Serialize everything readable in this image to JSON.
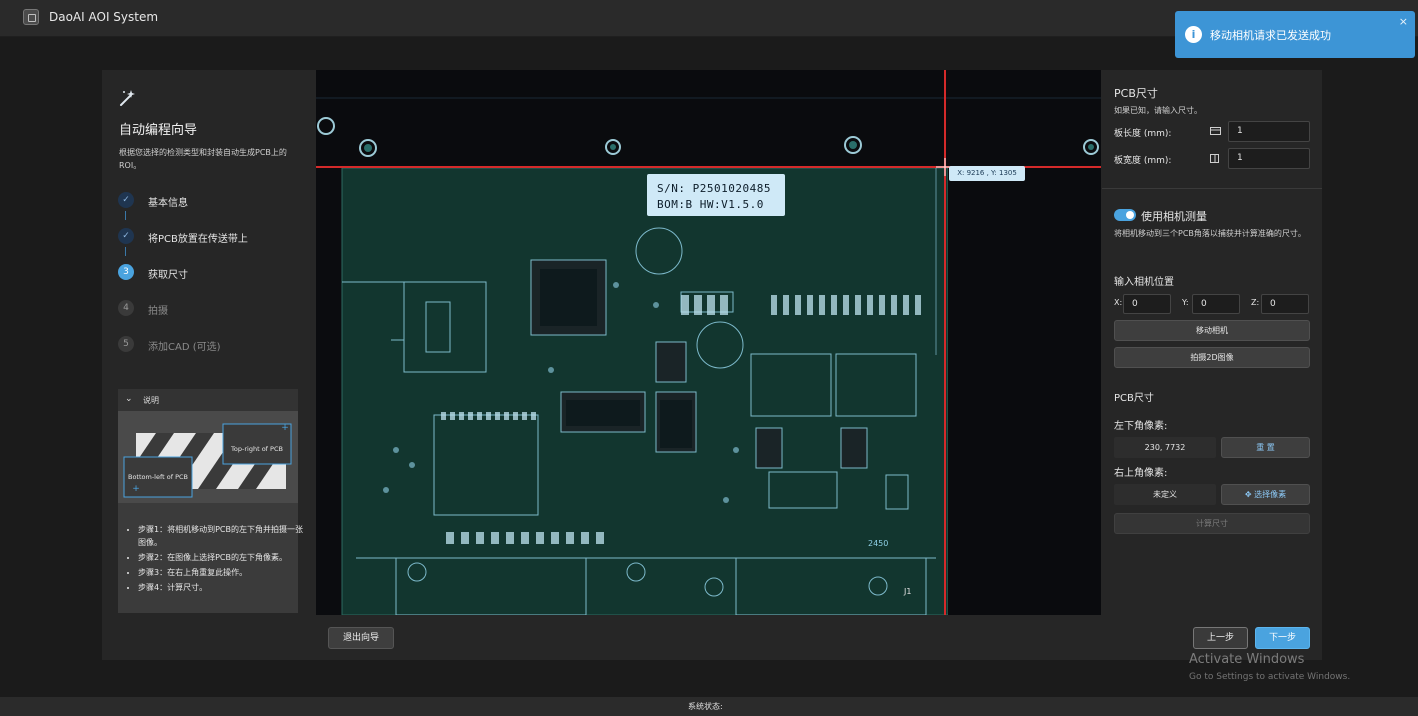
{
  "app": {
    "title": "DaoAI AOI System"
  },
  "notification": {
    "message": "移动相机请求已发送成功",
    "close": "×"
  },
  "wizard": {
    "title": "自动编程向导",
    "description": "根据您选择的检测类型和封装自动生成PCB上的ROI。",
    "steps": [
      {
        "number": "✓",
        "label": "基本信息",
        "state": "done"
      },
      {
        "number": "✓",
        "label": "将PCB放置在传送带上",
        "state": "done"
      },
      {
        "number": "3",
        "label": "获取尺寸",
        "state": "active"
      },
      {
        "number": "4",
        "label": "拍摄",
        "state": "pending"
      },
      {
        "number": "5",
        "label": "添加CAD (可选)",
        "state": "pending"
      }
    ]
  },
  "help": {
    "title": "说明",
    "diagram_top_right": "Top-right of PCB",
    "diagram_bottom_left": "Bottom-left of PCB",
    "steps": [
      "步骤1：将相机移动到PCB的左下角并拍摄一张图像。",
      "步骤2：在图像上选择PCB的左下角像素。",
      "步骤3：在右上角重复此操作。",
      "步骤4：计算尺寸。"
    ]
  },
  "camera": {
    "label_line1": "S/N: P2501020485",
    "label_line2": "BOM:B   HW:V1.5.0",
    "coord_readout": "X: 9216 , Y: 1305"
  },
  "right_panel": {
    "pcb_size_title": "PCB尺寸",
    "pcb_size_hint": "如果已知，请输入尺寸。",
    "length_label": "板长度 (mm):",
    "length_value": "1",
    "width_label": "板宽度 (mm):",
    "width_value": "1",
    "camera_measure_label": "使用相机测量",
    "camera_measure_desc": "将相机移动到三个PCB角落以捕获并计算准确的尺寸。",
    "camera_pos_title": "输入相机位置",
    "x_label": "X:",
    "x_value": "0",
    "y_label": "Y:",
    "y_value": "0",
    "z_label": "Z:",
    "z_value": "0",
    "move_camera": "移动相机",
    "capture_2d": "拍摄2D图像",
    "pcb_size_title2": "PCB尺寸",
    "bottom_left_label": "左下角像素:",
    "bottom_left_value": "230, 7732",
    "reset": "重 置",
    "top_right_label": "右上角像素:",
    "top_right_value": "未定义",
    "select_pixel": "✥ 选择像素",
    "calc_size": "计算尺寸"
  },
  "footer": {
    "exit": "退出向导",
    "prev": "上一步",
    "next": "下一步",
    "status": "系统状态:"
  },
  "watermark": {
    "title": "Activate Windows",
    "sub": "Go to Settings to activate Windows."
  },
  "colors": {
    "accent": "#4aa3df",
    "notification": "#3d95d6",
    "crosshair": "#d42a2a",
    "pcb_trace": "#8fd0e6"
  }
}
